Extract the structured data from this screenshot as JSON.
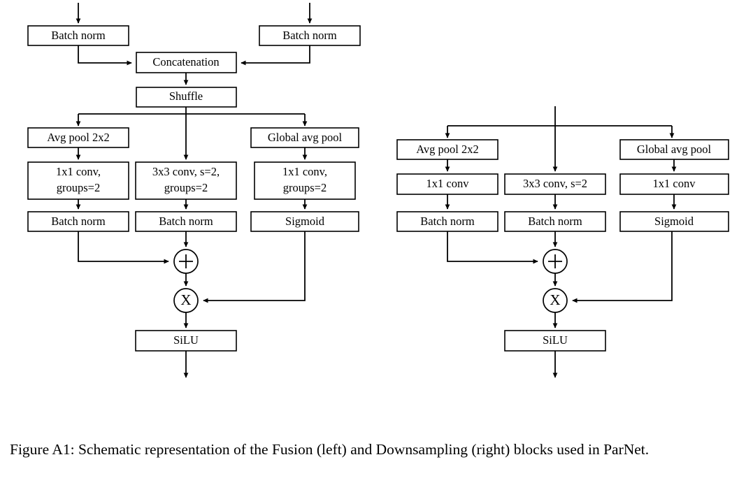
{
  "figure": {
    "caption": "Figure A1: Schematic representation of the Fusion (left) and Downsampling (right) blocks used in ParNet.",
    "caption_prefix": "Figure A1:",
    "blocks": [
      {
        "id": "fusion",
        "title": "Fusion",
        "side": "left",
        "nodes": [
          {
            "id": "bn-left-in",
            "label": "Batch norm",
            "type": "box"
          },
          {
            "id": "bn-right-in",
            "label": "Batch norm",
            "type": "box"
          },
          {
            "id": "concat",
            "label": "Concatenation",
            "type": "box"
          },
          {
            "id": "shuffle",
            "label": "Shuffle",
            "type": "box"
          },
          {
            "id": "avgpool",
            "label": "Avg pool 2x2",
            "type": "box"
          },
          {
            "id": "conv3x3",
            "label": "3x3 conv, s=2,|groups=2",
            "type": "box"
          },
          {
            "id": "globalavgpool",
            "label": "Global avg pool",
            "type": "box"
          },
          {
            "id": "conv1x1-left",
            "label": "1x1 conv,|groups=2",
            "type": "box"
          },
          {
            "id": "conv1x1-right",
            "label": "1x1 conv,|groups=2",
            "type": "box"
          },
          {
            "id": "bn-left",
            "label": "Batch norm",
            "type": "box"
          },
          {
            "id": "bn-mid",
            "label": "Batch norm",
            "type": "box"
          },
          {
            "id": "sigmoid",
            "label": "Sigmoid",
            "type": "box"
          },
          {
            "id": "add",
            "label": "+",
            "type": "circle"
          },
          {
            "id": "mul",
            "label": "X",
            "type": "circle"
          },
          {
            "id": "silu",
            "label": "SiLU",
            "type": "box"
          }
        ]
      },
      {
        "id": "downsampling",
        "title": "Downsampling",
        "side": "right",
        "nodes": [
          {
            "id": "avgpool",
            "label": "Avg pool 2x2",
            "type": "box"
          },
          {
            "id": "conv3x3",
            "label": "3x3 conv, s=2",
            "type": "box"
          },
          {
            "id": "globalavgpool",
            "label": "Global avg pool",
            "type": "box"
          },
          {
            "id": "conv1x1-left",
            "label": "1x1 conv",
            "type": "box"
          },
          {
            "id": "conv1x1-right",
            "label": "1x1 conv",
            "type": "box"
          },
          {
            "id": "bn-left",
            "label": "Batch norm",
            "type": "box"
          },
          {
            "id": "bn-mid",
            "label": "Batch norm",
            "type": "box"
          },
          {
            "id": "sigmoid",
            "label": "Sigmoid",
            "type": "box"
          },
          {
            "id": "add",
            "label": "+",
            "type": "circle"
          },
          {
            "id": "mul",
            "label": "X",
            "type": "circle"
          },
          {
            "id": "silu",
            "label": "SiLU",
            "type": "box"
          }
        ]
      }
    ],
    "labels": {
      "batch_norm": "Batch norm",
      "concatenation": "Concatenation",
      "shuffle": "Shuffle",
      "avg_pool_2x2": "Avg pool 2x2",
      "global_avg_pool": "Global avg pool",
      "conv3x3_groups": "3x3 conv, s=2,",
      "conv3x3_groups_2": "groups=2",
      "conv1x1_groups": "1x1 conv,",
      "conv1x1_groups_2": "groups=2",
      "conv3x3_plain": "3x3 conv, s=2",
      "conv1x1_plain": "1x1 conv",
      "sigmoid": "Sigmoid",
      "silu": "SiLU",
      "add_symbol": "+",
      "mul_symbol": "X"
    },
    "colors": {
      "stroke": "#000000",
      "fill": "#ffffff",
      "text": "#000000",
      "background": "#ffffff"
    }
  }
}
